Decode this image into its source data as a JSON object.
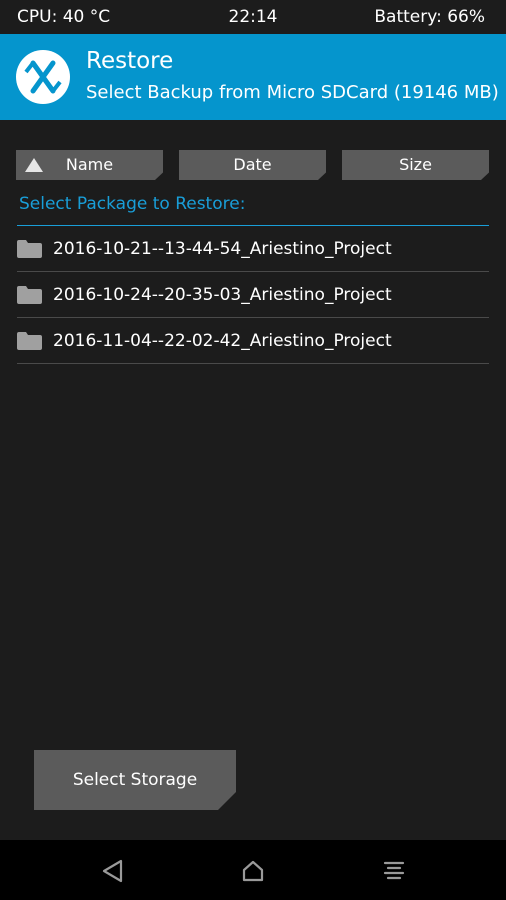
{
  "status_bar": {
    "cpu": "CPU: 40 °C",
    "time": "22:14",
    "battery": "Battery: 66%"
  },
  "header": {
    "logo_icon": "twrp-logo-icon",
    "title": "Restore",
    "subtitle": "Select Backup from Micro SDCard (19146 MB)"
  },
  "sort_buttons": {
    "name": "Name",
    "date": "Date",
    "size": "Size",
    "active_sort_icon": "sort-ascending-icon"
  },
  "list": {
    "label": "Select Package to Restore:",
    "item_icon": "folder-icon",
    "items": [
      {
        "name": "2016-10-21--13-44-54_Ariestino_Project"
      },
      {
        "name": "2016-10-24--20-35-03_Ariestino_Project"
      },
      {
        "name": "2016-11-04--22-02-42_Ariestino_Project"
      }
    ]
  },
  "storage_button": {
    "label": "Select Storage"
  },
  "nav_bar": {
    "icons": [
      "back-icon",
      "home-icon",
      "menu-icon"
    ]
  },
  "colors": {
    "accent": "#0595cd",
    "label_blue": "#199ed8",
    "background": "#1c1c1c",
    "button": "#5b5b5b",
    "navbar": "#000000"
  }
}
